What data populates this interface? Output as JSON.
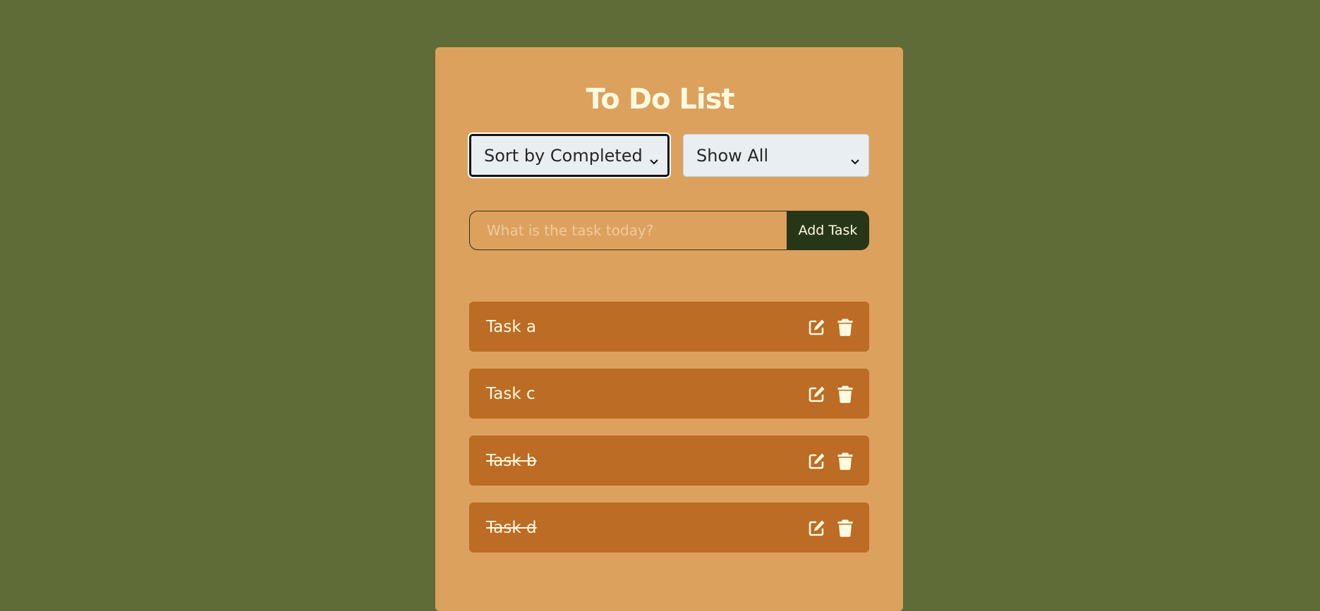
{
  "app": {
    "title": "To Do List"
  },
  "controls": {
    "sort_selected": "Sort by Completed",
    "filter_selected": "Show All"
  },
  "input": {
    "placeholder": "What is the task today?",
    "value": ""
  },
  "add_button": {
    "label": "Add Task"
  },
  "tasks": [
    {
      "label": "Task a",
      "completed": false
    },
    {
      "label": "Task c",
      "completed": false
    },
    {
      "label": "Task b",
      "completed": true
    },
    {
      "label": "Task d",
      "completed": true
    }
  ],
  "icons": {
    "edit": "edit-icon",
    "delete": "trash-icon",
    "dropdown": "chevron-down-icon"
  },
  "colors": {
    "background": "#606c38",
    "card": "#dda15e",
    "task": "#bc6c25",
    "button": "#283618",
    "text_light": "#fefae0"
  }
}
